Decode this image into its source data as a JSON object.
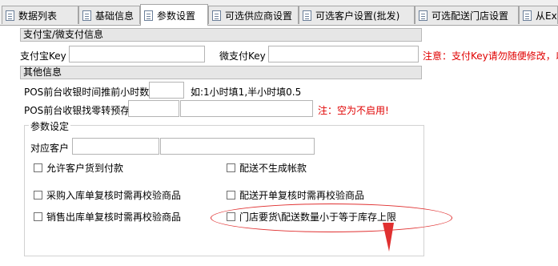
{
  "tabs": [
    {
      "label": "数据列表"
    },
    {
      "label": "基础信息"
    },
    {
      "label": "参数设置"
    },
    {
      "label": "可选供应商设置"
    },
    {
      "label": "可选客户设置(批发)"
    },
    {
      "label": "可选配送门店设置"
    },
    {
      "label": "从Ex"
    }
  ],
  "payment": {
    "section_title": "支付宝/微支付信息",
    "alipay_key_label": "支付宝Key",
    "wechat_key_label": "微支付Key",
    "warning": "注意：支付Key请勿随便修改，以"
  },
  "other": {
    "section_title": "其他信息",
    "pos_cutoff_label": "POS前台收银时间推前小时数",
    "pos_cutoff_hint": "如:1小时填1,半小时填0.5",
    "pos_change_label": "POS前台收银找零转预存",
    "pos_change_note": "注：空为不启用!"
  },
  "params": {
    "group_title": "参数设定",
    "customer_label": "对应客户",
    "options": {
      "allow_customer_pay_on_delivery": "允许客户货到付款",
      "no_account_for_delivery": "配送不生成帐款",
      "purchase_receipt_recheck": "采购入库单复核时需再校验商品",
      "delivery_order_recheck": "配送开单复核时需再校验商品",
      "sales_outbound_recheck": "销售出库单复核时需再校验商品",
      "store_request_limit": "门店要货\\配送数量小于等于库存上限"
    }
  },
  "annotation": {
    "color": "#e03030"
  }
}
